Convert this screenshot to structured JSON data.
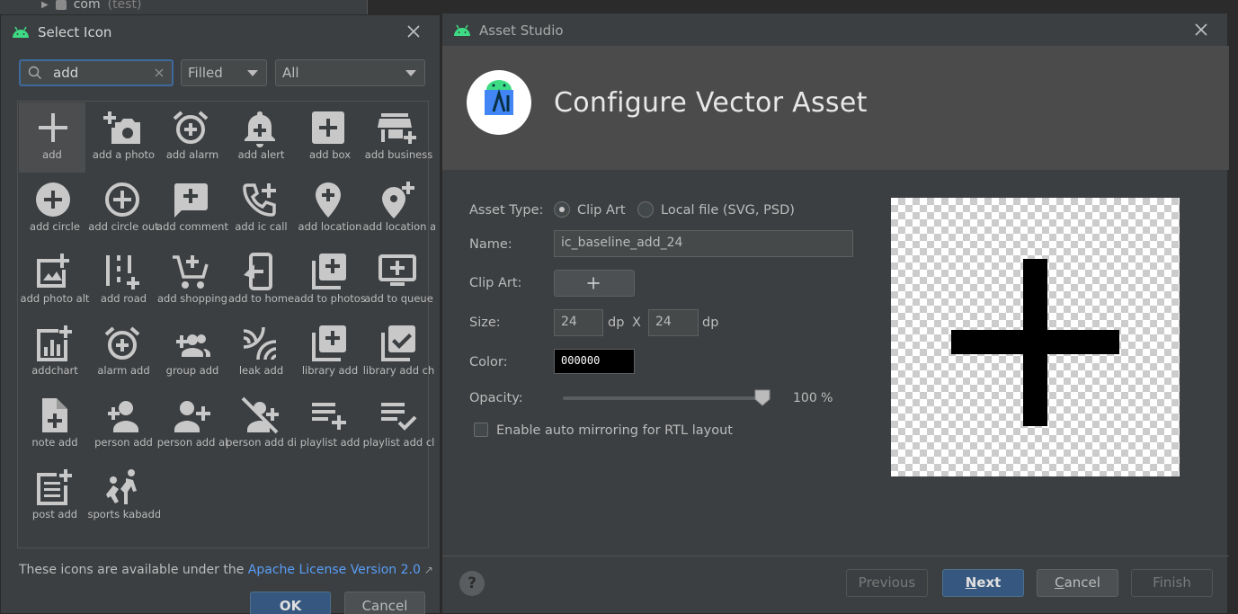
{
  "background": {
    "tree_item": "com",
    "tree_item_suffix": "(test)"
  },
  "select_icon": {
    "title": "Select Icon",
    "search_value": "add",
    "style_value": "Filled",
    "category_value": "All",
    "icons": [
      {
        "label": "add",
        "icon": "add-icon"
      },
      {
        "label": "add a photo",
        "icon": "add-a-photo-icon"
      },
      {
        "label": "add alarm",
        "icon": "add-alarm-icon"
      },
      {
        "label": "add alert",
        "icon": "add-alert-icon"
      },
      {
        "label": "add box",
        "icon": "add-box-icon"
      },
      {
        "label": "add business",
        "icon": "add-business-icon"
      },
      {
        "label": "add circle",
        "icon": "add-circle-icon"
      },
      {
        "label": "add circle out",
        "icon": "add-circle-outline-icon"
      },
      {
        "label": "add comment",
        "icon": "add-comment-icon"
      },
      {
        "label": "add ic call",
        "icon": "add-ic-call-icon"
      },
      {
        "label": "add location",
        "icon": "add-location-icon"
      },
      {
        "label": "add location a",
        "icon": "add-location-alt-icon"
      },
      {
        "label": "add photo alt",
        "icon": "add-photo-alternate-icon"
      },
      {
        "label": "add road",
        "icon": "add-road-icon"
      },
      {
        "label": "add shopping",
        "icon": "add-shopping-cart-icon"
      },
      {
        "label": "add to home",
        "icon": "add-to-home-screen-icon"
      },
      {
        "label": "add to photos",
        "icon": "add-to-photos-icon"
      },
      {
        "label": "add to queue",
        "icon": "add-to-queue-icon"
      },
      {
        "label": "addchart",
        "icon": "addchart-icon"
      },
      {
        "label": "alarm add",
        "icon": "alarm-add-icon"
      },
      {
        "label": "group add",
        "icon": "group-add-icon"
      },
      {
        "label": "leak add",
        "icon": "leak-add-icon"
      },
      {
        "label": "library add",
        "icon": "library-add-icon"
      },
      {
        "label": "library add ch",
        "icon": "library-add-check-icon"
      },
      {
        "label": "note add",
        "icon": "note-add-icon"
      },
      {
        "label": "person add",
        "icon": "person-add-icon"
      },
      {
        "label": "person add al",
        "icon": "person-add-alt-icon"
      },
      {
        "label": "person add di",
        "icon": "person-add-disabled-icon"
      },
      {
        "label": "playlist add",
        "icon": "playlist-add-icon"
      },
      {
        "label": "playlist add cl",
        "icon": "playlist-add-check-icon"
      },
      {
        "label": "post add",
        "icon": "post-add-icon"
      },
      {
        "label": "sports kabadd",
        "icon": "sports-kabaddi-icon"
      }
    ],
    "selected_index": 0,
    "license_prefix": "These icons are available under the",
    "license_link": "Apache License Version 2.0",
    "license_link_glyph": "↗",
    "ok_label": "OK",
    "cancel_label": "Cancel"
  },
  "asset_studio": {
    "title": "Asset Studio",
    "heading": "Configure Vector Asset",
    "asset_type_label": "Asset Type:",
    "radio_clip_art": "Clip Art",
    "radio_local_file": "Local file (SVG, PSD)",
    "asset_type_selected": "Clip Art",
    "name_label": "Name:",
    "name_value": "ic_baseline_add_24",
    "clip_art_label": "Clip Art:",
    "size_label": "Size:",
    "width_value": "24",
    "height_value": "24",
    "unit": "dp",
    "size_x": "X",
    "color_label": "Color:",
    "color_value": "000000",
    "opacity_label": "Opacity:",
    "opacity_percent": 100,
    "opacity_text": "100 %",
    "mirroring_label": "Enable auto mirroring for RTL layout",
    "mirroring_checked": false,
    "help_glyph": "?",
    "previous_label": "Previous",
    "next_label": "Next",
    "cancel_label": "Cancel",
    "finish_label": "Finish"
  },
  "colors": {
    "accent": "#365880",
    "link": "#589df6",
    "dialog_bg": "#3c3f41",
    "header_band": "#4b4b4b",
    "android_green": "#3ddc84"
  }
}
